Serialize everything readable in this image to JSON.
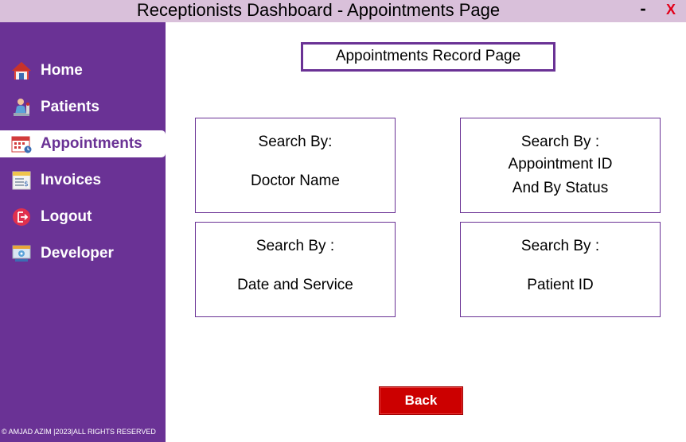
{
  "window": {
    "title": "Receptionists Dashboard - Appointments Page",
    "minimize_label": "-",
    "close_label": "X",
    "close_color": "#e2001a",
    "titlebar_color": "#d9c0da"
  },
  "sidebar": {
    "background": "#6a3295",
    "items": [
      {
        "label": "Home",
        "icon": "home-icon",
        "active": false
      },
      {
        "label": "Patients",
        "icon": "patients-icon",
        "active": false
      },
      {
        "label": "Appointments",
        "icon": "calendar-icon",
        "active": true
      },
      {
        "label": "Invoices",
        "icon": "invoice-icon",
        "active": false
      },
      {
        "label": "Logout",
        "icon": "logout-icon",
        "active": false
      },
      {
        "label": "Developer",
        "icon": "developer-icon",
        "active": false
      }
    ],
    "footer": "© AMJAD AZIM |2023|ALL RIGHTS RESERVED"
  },
  "main": {
    "record_title": "Appointments Record Page",
    "cards": [
      {
        "heading": "Search By:",
        "line1": "Doctor Name"
      },
      {
        "heading": "Search By :",
        "line1": "Appointment ID",
        "line2": "And By Status"
      },
      {
        "heading": "Search By :",
        "line1": "Date and Service"
      },
      {
        "heading": "Search By :",
        "line1": "Patient ID"
      }
    ],
    "back_label": "Back",
    "back_color": "#cc0000"
  }
}
